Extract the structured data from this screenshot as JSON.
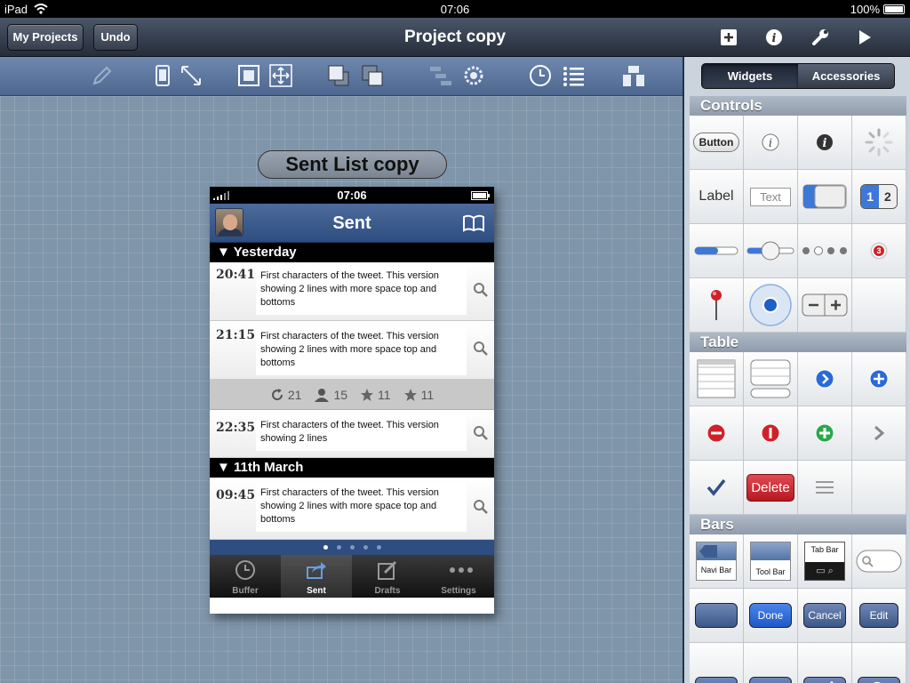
{
  "status": {
    "device": "iPad",
    "time": "07:06",
    "battery": "100%"
  },
  "navbar": {
    "title": "Project copy",
    "my_projects": "My Projects",
    "undo": "Undo"
  },
  "canvas": {
    "screen_label": "Sent List copy",
    "phone": {
      "time": "07:06",
      "title": "Sent",
      "sections": [
        "Yesterday",
        "11th March"
      ],
      "rows": [
        {
          "time": "20:41",
          "text": "First characters of the tweet. This version showing 2 lines with more space top and bottoms"
        },
        {
          "time": "21:15",
          "text": "First characters of the tweet. This version showing 2 lines with more space top and bottoms"
        },
        {
          "time": "22:35",
          "text": "First characters of the tweet. This version showing 2 lines"
        },
        {
          "time": "09:45",
          "text": "First characters of the tweet. This version showing 2 lines with more space top and bottoms"
        }
      ],
      "stats": {
        "retweets": "21",
        "followers": "15",
        "favorites": "11",
        "stars": "11"
      },
      "tabs": [
        "Buffer",
        "Sent",
        "Drafts",
        "Settings"
      ]
    }
  },
  "library": {
    "segments": [
      "Widgets",
      "Accessories"
    ],
    "sections": [
      "Controls",
      "Table",
      "Bars"
    ],
    "controls": {
      "button": "Button",
      "label": "Label",
      "text": "Text",
      "seg1": "1",
      "seg2": "2",
      "badge": "3"
    },
    "table": {
      "delete": "Delete"
    },
    "bars": {
      "navi": "Navi Bar",
      "tool": "Tool Bar",
      "tab": "Tab Bar",
      "done": "Done",
      "cancel": "Cancel",
      "edit": "Edit"
    }
  },
  "colors": {
    "accent": "#2e4d80",
    "delete_red": "#c0202a",
    "canvas": "#7f95aa"
  }
}
